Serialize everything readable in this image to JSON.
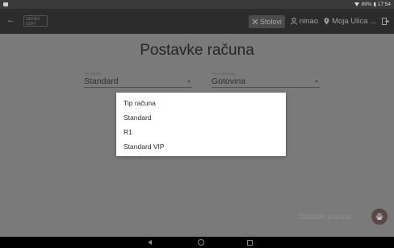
{
  "status_bar": {
    "status_text": "89% ▮ 17:54"
  },
  "app_bar": {
    "logo_text": "GENEX SOFT",
    "table_label": "Stolovi",
    "user_label": "ninao",
    "location_label": "Moja Ulica ..."
  },
  "page": {
    "title": "Postavke računa",
    "type_field": {
      "label": "Tip računa",
      "value": "Standard"
    },
    "payment_field": {
      "label": "Način plaćanja",
      "value": "Gotovina"
    },
    "extra_discount": "Dodatni popust..."
  },
  "dropdown": {
    "items": [
      "Tip računa",
      "Standard",
      "R1",
      "Standard VIP"
    ]
  },
  "colors": {
    "overlay": "#7a7a7a",
    "appbar": "#2c2c2c",
    "menu_bg": "#ffffff",
    "fab": "#5a4848"
  }
}
